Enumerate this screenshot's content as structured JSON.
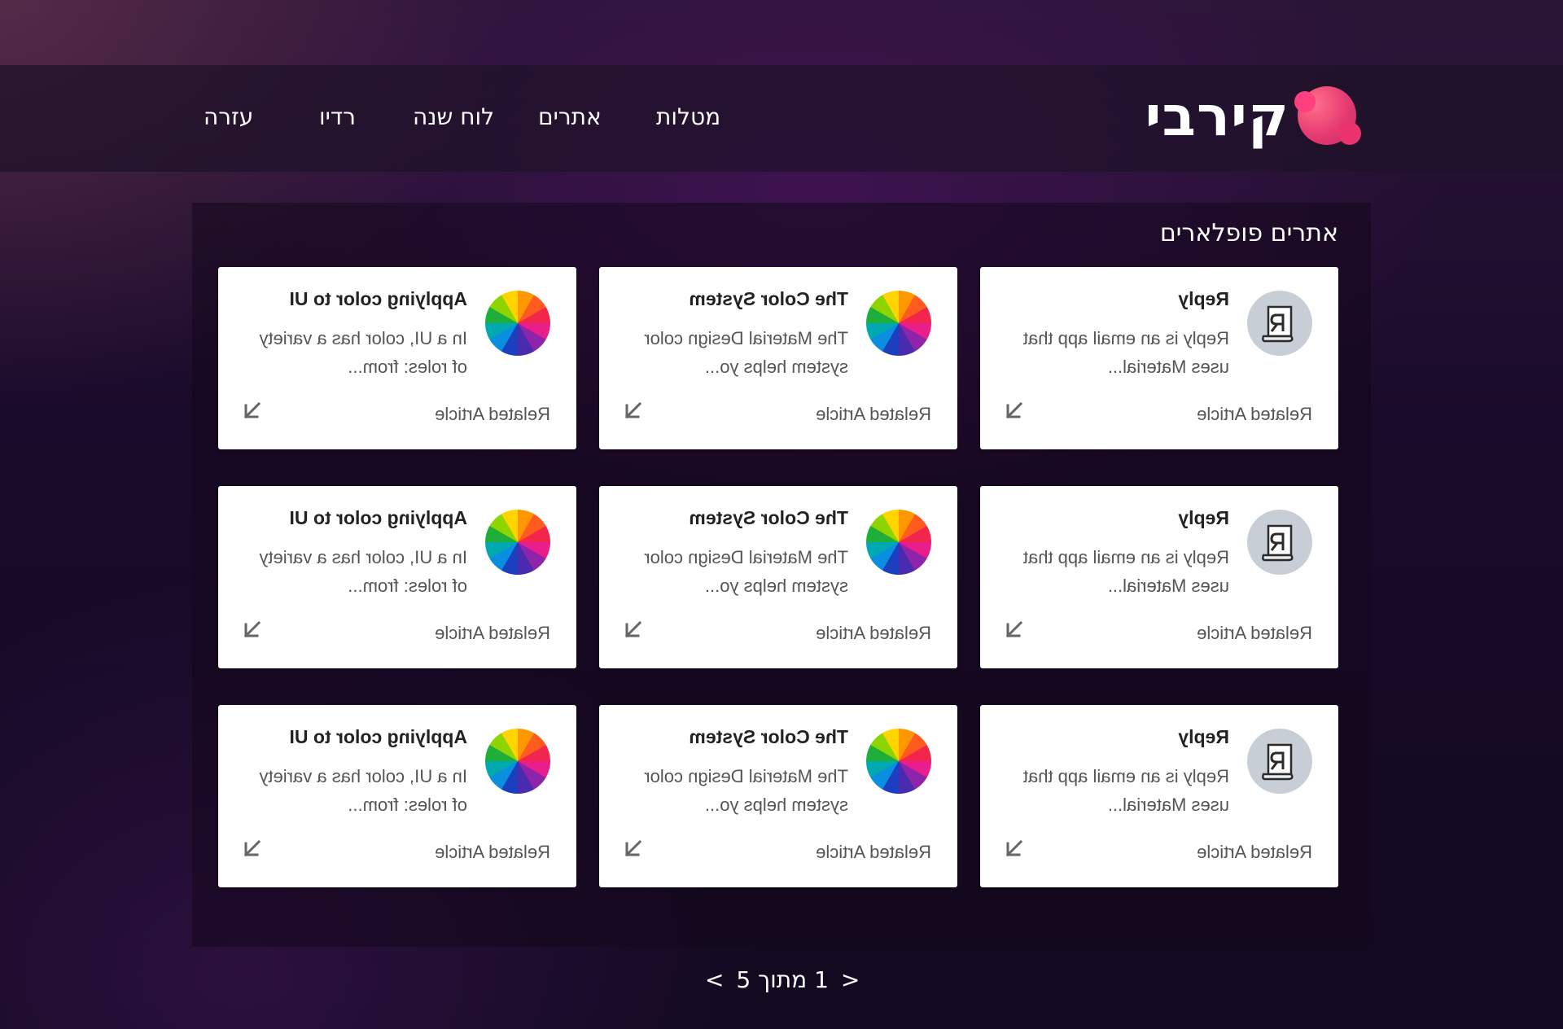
{
  "brand": {
    "name": "קירבי"
  },
  "nav": {
    "items": [
      {
        "label": "מטלות"
      },
      {
        "label": "אתרים"
      },
      {
        "label": "לוח שנה"
      },
      {
        "label": "רדיו"
      },
      {
        "label": "עזרה"
      }
    ]
  },
  "section": {
    "title": "אתרים פופלארים"
  },
  "cards": [
    {
      "title": "Reply",
      "desc": "Reply is an email app that uses Material...",
      "footer": "Related Article",
      "icon": "reply-logo-icon"
    },
    {
      "title": "The Color System",
      "desc": "The Material Design color system helps yo...",
      "footer": "Related Article",
      "icon": "color-wheel-icon"
    },
    {
      "title": "Applying color to UI",
      "desc": "In a UI, color has a variety of roles: from...",
      "footer": "Related Article",
      "icon": "color-wheel-icon"
    },
    {
      "title": "Reply",
      "desc": "Reply is an email app that uses Material...",
      "footer": "Related Article",
      "icon": "reply-logo-icon"
    },
    {
      "title": "The Color System",
      "desc": "The Material Design color system helps yo...",
      "footer": "Related Article",
      "icon": "color-wheel-icon"
    },
    {
      "title": "Applying color to UI",
      "desc": "In a UI, color has a variety of roles: from...",
      "footer": "Related Article",
      "icon": "color-wheel-icon"
    },
    {
      "title": "Reply",
      "desc": "Reply is an email app that uses Material...",
      "footer": "Related Article",
      "icon": "reply-logo-icon"
    },
    {
      "title": "The Color System",
      "desc": "The Material Design color system helps yo...",
      "footer": "Related Article",
      "icon": "color-wheel-icon"
    },
    {
      "title": "Applying color to UI",
      "desc": "In a UI, color has a variety of roles: from...",
      "footer": "Related Article",
      "icon": "color-wheel-icon"
    }
  ],
  "pagination": {
    "prev": "<",
    "next": ">",
    "current": "1",
    "separator": "מתוך",
    "total": "5"
  },
  "colors": {
    "accent": "#e63b72",
    "text_on_dark": "#ffffff",
    "card_bg": "#ffffff"
  }
}
